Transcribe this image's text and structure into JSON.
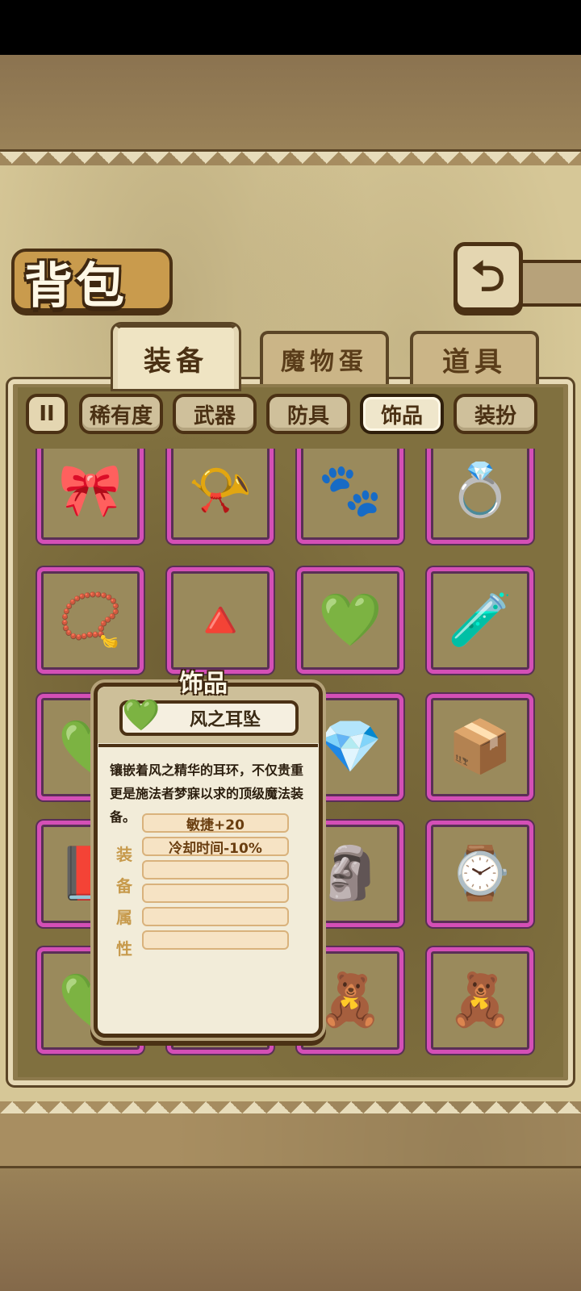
{
  "page": {
    "title": "背包"
  },
  "tabs": [
    {
      "label": "装备",
      "active": true
    },
    {
      "label": "魔物蛋",
      "active": false
    },
    {
      "label": "道具",
      "active": false
    }
  ],
  "filters": {
    "toggle_icon": "II",
    "items": [
      {
        "label": "稀有度",
        "active": false
      },
      {
        "label": "武器",
        "active": false
      },
      {
        "label": "防具",
        "active": false
      },
      {
        "label": "饰品",
        "active": true
      },
      {
        "label": "装扮",
        "active": false
      }
    ]
  },
  "back_button": {
    "icon": "back-arrow-icon",
    "glyph": "⮌"
  },
  "grid": {
    "rarity_color": "#d44fb6",
    "items": [
      {
        "name": "knot-tassel-icon",
        "glyph": "🎀"
      },
      {
        "name": "horn-icon",
        "glyph": "📯"
      },
      {
        "name": "cat-paw-icon",
        "glyph": "🐾"
      },
      {
        "name": "ring-icon",
        "glyph": "💍"
      },
      {
        "name": "necklace-icon",
        "glyph": "📿"
      },
      {
        "name": "triangle-eye-icon",
        "glyph": "🔺"
      },
      {
        "name": "earring-icon",
        "glyph": "💚"
      },
      {
        "name": "bottle-fairy-icon",
        "glyph": "🧪"
      },
      {
        "name": "earring-icon",
        "glyph": "💚"
      },
      {
        "name": "hidden-slot",
        "glyph": ""
      },
      {
        "name": "dark-crystal-icon",
        "glyph": "💎"
      },
      {
        "name": "wooden-chest-icon",
        "glyph": "📦"
      },
      {
        "name": "red-book-icon",
        "glyph": "📕"
      },
      {
        "name": "hidden-slot",
        "glyph": ""
      },
      {
        "name": "stone-tablet-icon",
        "glyph": "🗿"
      },
      {
        "name": "pocket-watch-icon",
        "glyph": "⌚"
      },
      {
        "name": "earring-icon",
        "glyph": "💚"
      },
      {
        "name": "hidden-slot",
        "glyph": ""
      },
      {
        "name": "doll-icon",
        "glyph": "🧸"
      },
      {
        "name": "doll-icon",
        "glyph": "🧸"
      }
    ]
  },
  "tooltip": {
    "category": "饰品",
    "name": "风之耳坠",
    "icon_glyph": "💚",
    "description": "镶嵌着风之精华的耳环，不仅贵重更是施法者梦寐以求的顶级魔法装备。",
    "attr_label": [
      "装",
      "备",
      "属",
      "性"
    ],
    "attributes": [
      "敏捷+20",
      "冷却时间-10%",
      "",
      "",
      "",
      ""
    ]
  }
}
